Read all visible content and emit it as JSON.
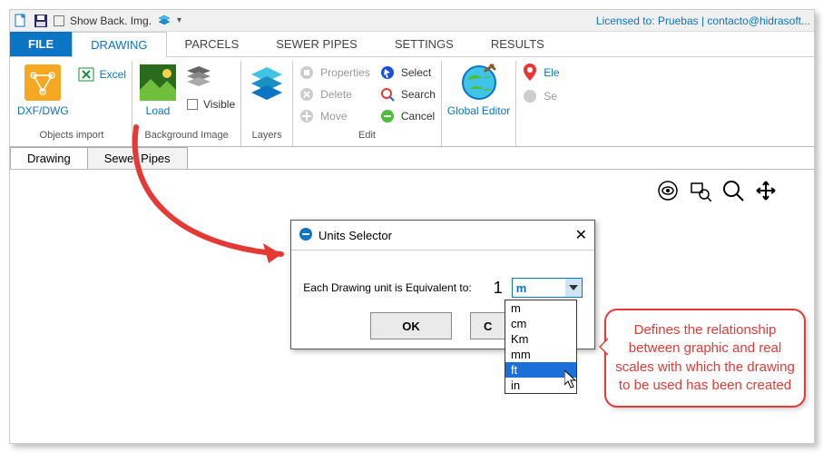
{
  "titlebar": {
    "show_back_img": "Show Back. Img.",
    "licensed": "Licensed to: Pruebas | contacto@hidrasoft..."
  },
  "menu": {
    "file": "FILE",
    "tabs": [
      "DRAWING",
      "PARCELS",
      "SEWER PIPES",
      "SETTINGS",
      "RESULTS"
    ]
  },
  "ribbon": {
    "objects_import": {
      "label": "Objects import",
      "dxf": "DXF/DWG",
      "excel": "Excel"
    },
    "background": {
      "label": "Background Image",
      "load": "Load",
      "visible": "Visible"
    },
    "layers": {
      "label": "Layers"
    },
    "edit": {
      "label": "Edit",
      "properties": "Properties",
      "delete": "Delete",
      "move": "Move",
      "select": "Select",
      "search": "Search",
      "cancel": "Cancel"
    },
    "global_editor": "Global Editor",
    "right": {
      "ele": "Ele",
      "se": "Se"
    }
  },
  "strip": {
    "drawing": "Drawing",
    "sewer": "Sewer Pipes"
  },
  "dialog": {
    "title": "Units Selector",
    "prompt": "Each Drawing unit is Equivalent to:",
    "value": "1",
    "selected": "m",
    "ok": "OK",
    "cancel_partial": "C"
  },
  "dropdown": {
    "options": [
      "m",
      "cm",
      "Km",
      "mm",
      "ft",
      "in"
    ],
    "highlight": "ft"
  },
  "callout": {
    "text": "Defines the relationship between graphic and real scales with which the drawing to be used has been created"
  }
}
